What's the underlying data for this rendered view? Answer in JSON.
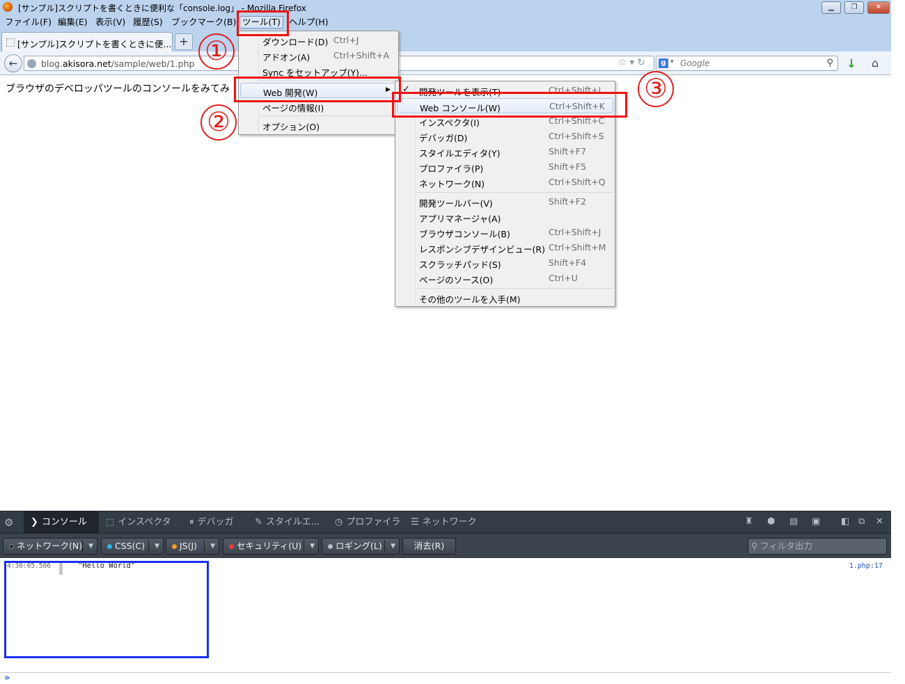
{
  "window": {
    "title": "[サンプル]スクリプトを書くときに便利な「console.log」 - Mozilla Firefox",
    "controls": {
      "minimize": "▁",
      "restore": "❐",
      "close": "✕"
    }
  },
  "menubar": {
    "file": "ファイル(F)",
    "edit": "編集(E)",
    "view": "表示(V)",
    "history": "履歴(S)",
    "bookmarks": "ブックマーク(B)",
    "tools": "ツール(T)",
    "help": "ヘルプ(H)"
  },
  "tab": {
    "title": "[サンプル]スクリプトを書くときに便...",
    "new_tab": "+"
  },
  "nav": {
    "back": "←",
    "url_prefix": "blog.",
    "url_domain": "akisora.net",
    "url_path": "/sample/web/1.php",
    "url_icons": "☆▾↻",
    "search_engine": "g",
    "search_caret": "▾",
    "search_placeholder": "Google",
    "search_icon": "⚲",
    "download_icon": "↓",
    "home_icon": "⌂"
  },
  "page": {
    "text": "ブラウザのデベロッパツールのコンソールをみてみ"
  },
  "tools_menu": {
    "items": [
      {
        "label": "ダウンロード(D)",
        "shortcut": "Ctrl+J"
      },
      {
        "label": "アドオン(A)",
        "shortcut": "Ctrl+Shift+A"
      },
      {
        "label": "Sync をセットアップ(Y)...",
        "shortcut": ""
      },
      {
        "label": "Web 開発(W)",
        "shortcut": ""
      },
      {
        "label": "ページの情報(I)",
        "shortcut": ""
      },
      {
        "label": "オプション(O)",
        "shortcut": ""
      }
    ]
  },
  "webdev_menu": {
    "items": [
      {
        "label": "開発ツールを表示(T)",
        "shortcut": "Ctrl+Shift+I"
      },
      {
        "label": "Web コンソール(W)",
        "shortcut": "Ctrl+Shift+K"
      },
      {
        "label": "インスペクタ(I)",
        "shortcut": "Ctrl+Shift+C"
      },
      {
        "label": "デバッガ(D)",
        "shortcut": "Ctrl+Shift+S"
      },
      {
        "label": "スタイルエディタ(Y)",
        "shortcut": "Shift+F7"
      },
      {
        "label": "プロファイラ(P)",
        "shortcut": "Shift+F5"
      },
      {
        "label": "ネットワーク(N)",
        "shortcut": "Ctrl+Shift+Q"
      },
      {
        "label": "開発ツールバー(V)",
        "shortcut": "Shift+F2"
      },
      {
        "label": "アプリマネージャ(A)",
        "shortcut": ""
      },
      {
        "label": "ブラウザコンソール(B)",
        "shortcut": "Ctrl+Shift+J"
      },
      {
        "label": "レスポンシブデザインビュー(R)",
        "shortcut": "Ctrl+Shift+M"
      },
      {
        "label": "スクラッチパッド(S)",
        "shortcut": "Shift+F4"
      },
      {
        "label": "ページのソース(O)",
        "shortcut": "Ctrl+U"
      },
      {
        "label": "その他のツールを入手(M)",
        "shortcut": ""
      }
    ]
  },
  "annotations": {
    "step1": "①",
    "step2": "②",
    "step3": "③"
  },
  "devtools": {
    "tabs": [
      "コンソール",
      "インスペクタ",
      "デバッガ",
      "スタイルエ...",
      "プロファイラ",
      "ネットワーク"
    ],
    "filters": {
      "network": "ネットワーク(N)",
      "css": "CSS(C)",
      "js": "JS(J)",
      "security": "セキュリティ(U)",
      "logging": "ロギング(L)",
      "clear": "消去(R)"
    },
    "filter_placeholder": "フィルタ出力",
    "log": {
      "timestamp": "4:30:05.506",
      "message": "\"Hello World\"",
      "location": "1.php:17"
    },
    "prompt": "»"
  },
  "colors": {
    "annotation_red": "#ee1111",
    "annotation_blue": "#1a2ef0",
    "menubar_bg": "#bcd3ee",
    "devtools_bg": "#343c45"
  }
}
